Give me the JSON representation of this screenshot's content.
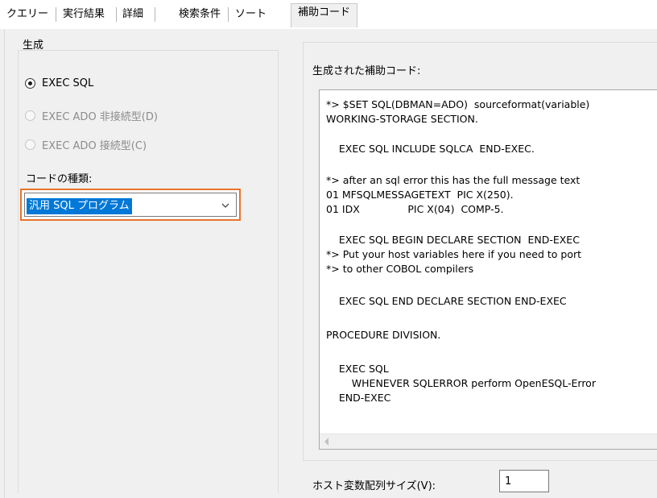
{
  "tabs": [
    {
      "label": "クエリー"
    },
    {
      "label": "実行結果"
    },
    {
      "label": "詳細"
    },
    {
      "label": "検索条件"
    },
    {
      "label": "ソート"
    },
    {
      "label": "補助コード",
      "active": true
    }
  ],
  "generate": {
    "group_title": "生成",
    "options": [
      {
        "label": "EXEC SQL",
        "checked": true,
        "enabled": true
      },
      {
        "label": "EXEC ADO 非接続型(D)",
        "checked": false,
        "enabled": false
      },
      {
        "label": "EXEC ADO 接続型(C)",
        "checked": false,
        "enabled": false
      }
    ],
    "code_kind_label": "コードの種類:",
    "code_kind_selected": "汎用 SQL プログラム",
    "highlight_color": "#e8742a"
  },
  "generated": {
    "label": "生成された補助コード:",
    "lines": [
      "*> $SET SQL(DBMAN=ADO)  sourceformat(variable)",
      "WORKING-STORAGE SECTION.",
      "",
      "    EXEC SQL INCLUDE SQLCA  END-EXEC.",
      "",
      "*> after an sql error this has the full message text",
      "01 MFSQLMESSAGETEXT  PIC X(250).",
      "01 IDX               PIC X(04)  COMP-5.",
      "",
      "    EXEC SQL BEGIN DECLARE SECTION  END-EXEC",
      "*> Put your host variables here if you need to port",
      "*> to other COBOL compilers",
      "",
      "    EXEC SQL END DECLARE SECTION END-EXEC",
      "",
      "PROCEDURE DIVISION.",
      "",
      "    EXEC SQL",
      "        WHENEVER SQLERROR perform OpenESQL-Error",
      "    END-EXEC"
    ]
  },
  "host_array": {
    "label": "ホスト変数配列サイズ(V):",
    "value": "1"
  }
}
